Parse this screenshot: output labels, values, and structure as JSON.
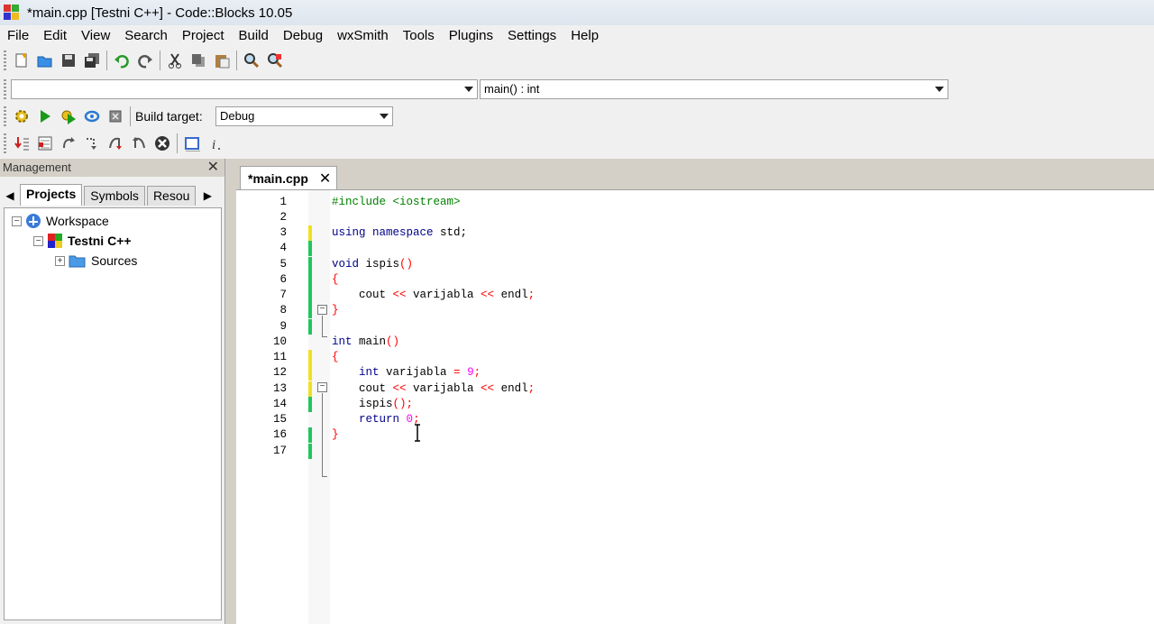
{
  "window": {
    "title": "*main.cpp [Testni C++] - Code::Blocks 10.05"
  },
  "menu": [
    "File",
    "Edit",
    "View",
    "Search",
    "Project",
    "Build",
    "Debug",
    "wxSmith",
    "Tools",
    "Plugins",
    "Settings",
    "Help"
  ],
  "symbols_bar": {
    "scope_value": "",
    "function_value": "main() : int"
  },
  "compiler_bar": {
    "build_target_label": "Build target:",
    "build_target_value": "Debug"
  },
  "management": {
    "title": "Management",
    "tabs": [
      "Projects",
      "Symbols",
      "Resou"
    ],
    "tree": {
      "workspace": "Workspace",
      "project": "Testni C++",
      "folder": "Sources"
    }
  },
  "editor": {
    "tab_label": "*main.cpp",
    "lines": [
      {
        "n": "1"
      },
      {
        "n": "2"
      },
      {
        "n": "3"
      },
      {
        "n": "4"
      },
      {
        "n": "5"
      },
      {
        "n": "6"
      },
      {
        "n": "7"
      },
      {
        "n": "8"
      },
      {
        "n": "9"
      },
      {
        "n": "10"
      },
      {
        "n": "11"
      },
      {
        "n": "12"
      },
      {
        "n": "13"
      },
      {
        "n": "14"
      },
      {
        "n": "15"
      },
      {
        "n": "16"
      },
      {
        "n": "17"
      }
    ],
    "code": {
      "l1_pp": "#include <iostream>",
      "l3_using": "using",
      "l3_ns": "namespace",
      "l3_rest": " std;",
      "l5_void": "void",
      "l5_rest": " ispis",
      "l5_paren": "()",
      "l6": "{",
      "l7_a": "    cout ",
      "l7_op1": "<<",
      "l7_b": " varijabla ",
      "l7_op2": "<<",
      "l7_c": " endl",
      "l7_semi": ";",
      "l8": "}",
      "l10_int": "int",
      "l10_rest": " main",
      "l10_paren": "()",
      "l11": "{",
      "l12_indent": "    ",
      "l12_int": "int",
      "l12_b": " varijabla ",
      "l12_eq": "=",
      "l12_sp": " ",
      "l12_num": "9",
      "l12_semi": ";",
      "l13_a": "    cout ",
      "l13_op1": "<<",
      "l13_b": " varijabla ",
      "l13_op2": "<<",
      "l13_c": " endl",
      "l13_semi": ";",
      "l14_a": "    ispis",
      "l14_paren": "();",
      "l15_indent": "    ",
      "l15_ret": "return",
      "l15_sp": " ",
      "l15_num": "0",
      "l15_semi": ";",
      "l16": "}"
    }
  },
  "colors": {
    "modified": "#f0e020",
    "saved": "#22c55e",
    "keyword": "#00008b",
    "preprocessor": "#008000",
    "operator": "#ff0000",
    "number": "#ff00ff"
  }
}
